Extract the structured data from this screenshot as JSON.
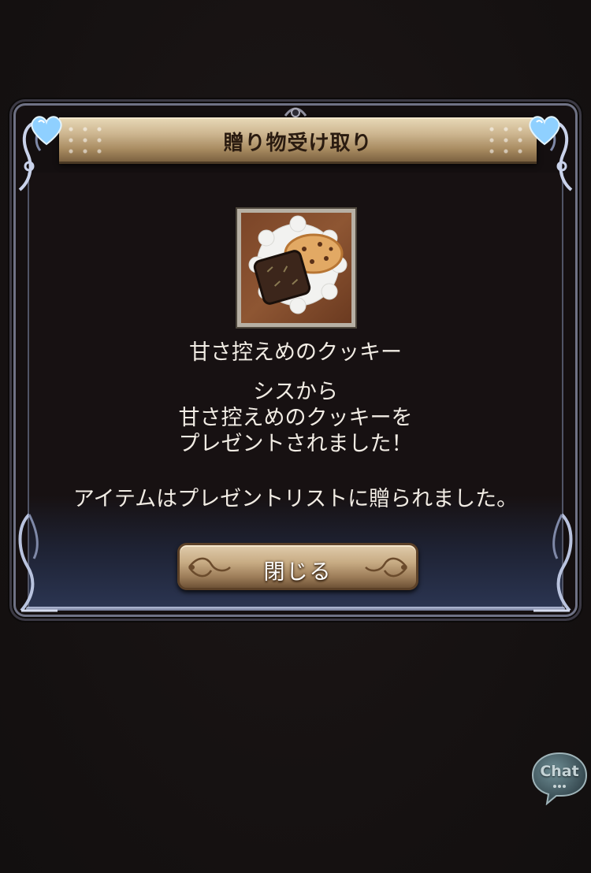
{
  "dialog": {
    "title": "贈り物受け取り",
    "item": {
      "name": "甘さ控えめのクッキー",
      "icon": "cookie-icon"
    },
    "message_lines": [
      "シスから",
      "甘さ控えめのクッキーを",
      "プレゼントされました！"
    ],
    "notice": "アイテムはプレゼントリストに贈られました。",
    "close_label": "閉じる"
  },
  "chat": {
    "label": "Chat",
    "icon": "chat-bubble-icon"
  },
  "colors": {
    "background": "#171212",
    "banner": "#cdb690",
    "text": "#f1ece4",
    "frame_accent": "#8fd0ff"
  }
}
